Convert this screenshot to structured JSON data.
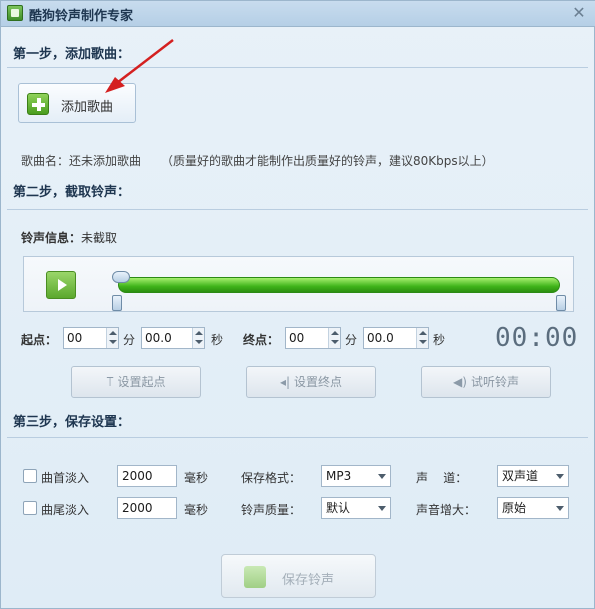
{
  "window": {
    "title": "酷狗铃声制作专家"
  },
  "step1": {
    "heading": "第一步，添加歌曲：",
    "add_button": "添加歌曲",
    "song_name_label": "歌曲名：还未添加歌曲",
    "hint": "（质量好的歌曲才能制作出质量好的铃声，建议80Kbps以上）"
  },
  "step2": {
    "heading": "第二步，截取铃声：",
    "info_label": "铃声信息：",
    "info_value": "未截取",
    "start_label": "起点：",
    "start_min": "00",
    "start_min_unit": "分",
    "start_sec": "00.0",
    "start_sec_unit": "秒",
    "end_label": "终点：",
    "end_min": "00",
    "end_min_unit": "分",
    "end_sec": "00.0",
    "end_sec_unit": "秒",
    "clock": "00:00",
    "btn_set_start": "设置起点",
    "btn_set_end": "设置终点",
    "btn_preview": "试听铃声"
  },
  "step3": {
    "heading": "第三步，保存设置：",
    "fade_in_label": "曲首淡入",
    "fade_in_value": "2000",
    "fade_in_unit": "毫秒",
    "fade_out_label": "曲尾淡入",
    "fade_out_value": "2000",
    "fade_out_unit": "毫秒",
    "format_label": "保存格式：",
    "format_value": "MP3",
    "quality_label": "铃声质量：",
    "quality_value": "默认",
    "channel_label": "声    道：",
    "channel_value": "双声道",
    "boost_label": "声音增大：",
    "boost_value": "原始",
    "save_button": "保存铃声"
  },
  "colors": {
    "accent_green": "#3fb31a",
    "annotation_red": "#d42020",
    "title_text": "#1e3650"
  }
}
